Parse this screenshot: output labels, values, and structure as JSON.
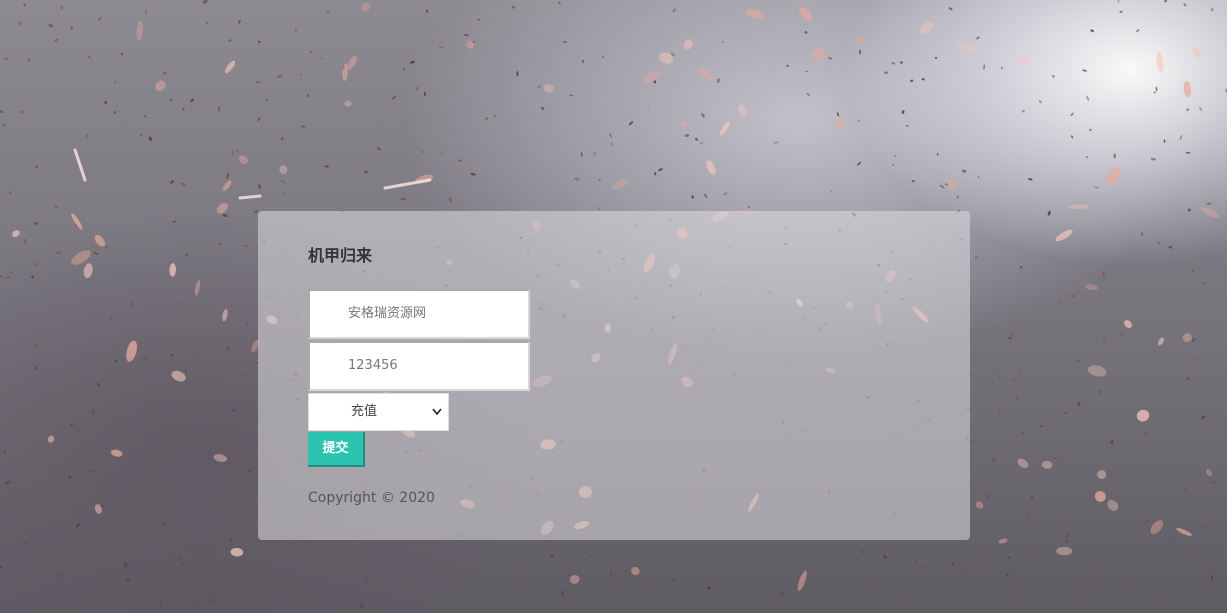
{
  "login": {
    "title": "机甲归来",
    "username_value": "安格瑞资源网",
    "password_value": "123456",
    "type_select": {
      "selected": "充值",
      "arrow_icon": "chevron-down-icon"
    },
    "submit_label": "提交",
    "copyright": "Copyright © 2020"
  },
  "colors": {
    "submit_bg": "#2bc4b0",
    "panel_bg": "rgba(220,220,224,0.55)",
    "petal": "#f0b8b0"
  }
}
